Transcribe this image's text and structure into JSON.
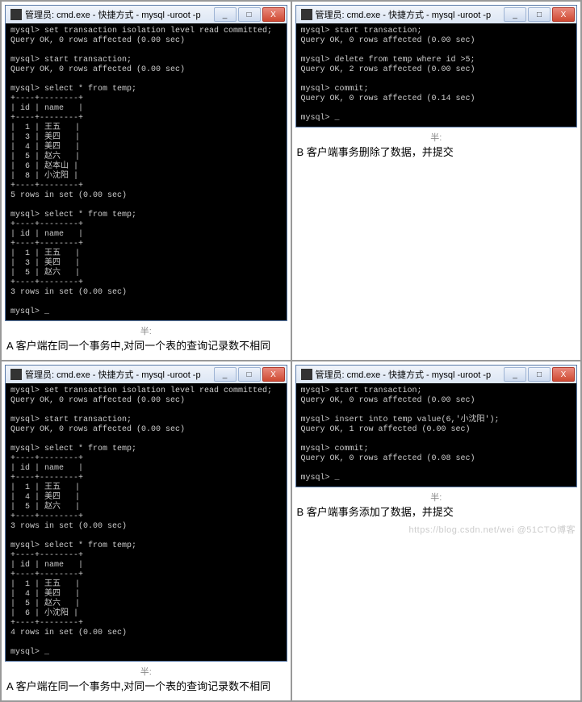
{
  "watermark": "https://blog.csdn.net/wei @51CTO博客",
  "ime": "半:",
  "window_title": "管理员: cmd.exe - 快捷方式 - mysql  -uroot -p",
  "btn_min": "_",
  "btn_max": "□",
  "btn_close": "X",
  "termA1": "mysql> set transaction isolation level read committed;\nQuery OK, 0 rows affected (0.00 sec)\n\nmysql> start transaction;\nQuery OK, 0 rows affected (0.00 sec)\n\nmysql> select * from temp;\n+----+--------+\n| id | name   |\n+----+--------+\n|  1 | 王五   |\n|  3 | 美四   |\n|  4 | 美四   |\n|  5 | 赵六   |\n|  6 | 赵本山 |\n|  8 | 小沈阳 |\n+----+--------+\n5 rows in set (0.00 sec)\n\nmysql> select * from temp;\n+----+--------+\n| id | name   |\n+----+--------+\n|  1 | 王五   |\n|  3 | 美四   |\n|  5 | 赵六   |\n+----+--------+\n3 rows in set (0.00 sec)\n\nmysql> _",
  "termB1": "mysql> start transaction;\nQuery OK, 0 rows affected (0.00 sec)\n\nmysql> delete from temp where id >5;\nQuery OK, 2 rows affected (0.00 sec)\n\nmysql> commit;\nQuery OK, 0 rows affected (0.14 sec)\n\nmysql> _",
  "termA2": "mysql> set transaction isolation level read committed;\nQuery OK, 0 rows affected (0.00 sec)\n\nmysql> start transaction;\nQuery OK, 0 rows affected (0.00 sec)\n\nmysql> select * from temp;\n+----+--------+\n| id | name   |\n+----+--------+\n|  1 | 王五   |\n|  4 | 美四   |\n|  5 | 赵六   |\n+----+--------+\n3 rows in set (0.00 sec)\n\nmysql> select * from temp;\n+----+--------+\n| id | name   |\n+----+--------+\n|  1 | 王五   |\n|  4 | 美四   |\n|  5 | 赵六   |\n|  6 | 小沈阳 |\n+----+--------+\n4 rows in set (0.00 sec)\n\nmysql> _",
  "termB2": "mysql> start transaction;\nQuery OK, 0 rows affected (0.00 sec)\n\nmysql> insert into temp value(6,'小沈阳');\nQuery OK, 1 row affected (0.00 sec)\n\nmysql> commit;\nQuery OK, 0 rows affected (0.08 sec)\n\nmysql> _",
  "captionA1": "A 客户端在同一个事务中,对同一个表的查询记录数不相同",
  "captionB1": "B 客户端事务删除了数据，并提交",
  "captionA2": "A 客户端在同一个事务中,对同一个表的查询记录数不相同",
  "captionB2": "B 客户端事务添加了数据，并提交"
}
